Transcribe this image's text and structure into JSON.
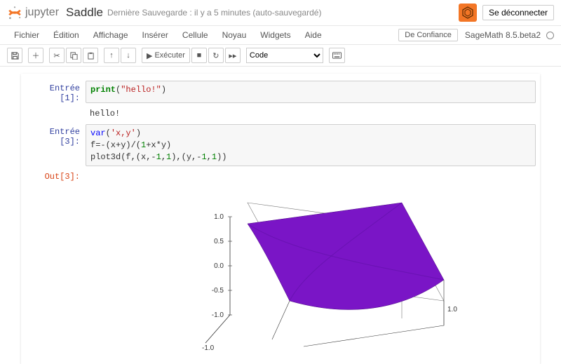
{
  "header": {
    "logo_text": "jupyter",
    "notebook_name": "Saddle",
    "save_status": "Dernière Sauvegarde : il y a 5 minutes  (auto-sauvegardé)",
    "logout": "Se déconnecter"
  },
  "menubar": {
    "items": [
      "Fichier",
      "Édition",
      "Affichage",
      "Insérer",
      "Cellule",
      "Noyau",
      "Widgets",
      "Aide"
    ],
    "trusted": "De Confiance",
    "kernel": "SageMath 8.5.beta2"
  },
  "toolbar": {
    "run_label": "Exécuter",
    "cell_type": "Code"
  },
  "cells": [
    {
      "in_prompt": "Entrée [1]:",
      "code_tokens": [
        [
          "kw",
          "print"
        ],
        [
          "p",
          "("
        ],
        [
          "str",
          "\"hello!\""
        ],
        [
          "p",
          ")"
        ]
      ],
      "output": "hello!"
    },
    {
      "in_prompt": "Entrée [3]:",
      "code_lines": [
        [
          [
            "builtin",
            "var"
          ],
          [
            "p",
            "("
          ],
          [
            "str",
            "'x,y'"
          ],
          [
            "p",
            ")"
          ]
        ],
        [
          [
            "p",
            "f=-(x+y)/("
          ],
          [
            "num",
            "1"
          ],
          [
            "p",
            "+x*y)"
          ]
        ],
        [
          [
            "p",
            "plot3d(f,(x,-"
          ],
          [
            "num",
            "1"
          ],
          [
            "p",
            ","
          ],
          [
            "num",
            "1"
          ],
          [
            "p",
            "),(y,-"
          ],
          [
            "num",
            "1"
          ],
          [
            "p",
            ","
          ],
          [
            "num",
            "1"
          ],
          [
            "p",
            "))"
          ]
        ]
      ],
      "out_prompt": "Out[3]:"
    }
  ],
  "chart_data": {
    "type": "surface3d",
    "title": "",
    "xlabel": "",
    "ylabel": "",
    "zlabel": "",
    "x_range": [
      -1.0,
      1.0
    ],
    "y_range": [
      -1.0,
      1.0
    ],
    "z_range": [
      -1.0,
      1.0
    ],
    "z_ticks": [
      -1.0,
      -0.5,
      0.0,
      0.5,
      1.0
    ],
    "x_tick_visible": [
      1.0
    ],
    "formula": "f = -(x+y)/(1+x*y)"
  }
}
